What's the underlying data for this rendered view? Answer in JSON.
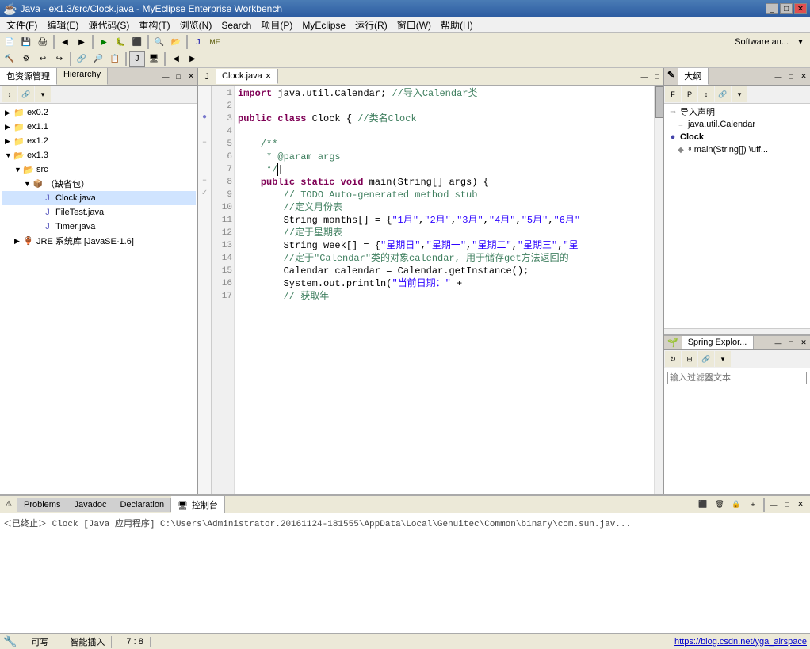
{
  "titleBar": {
    "title": "Java - ex1.3/src/Clock.java - MyEclipse Enterprise Workbench",
    "controls": [
      "minimize",
      "maximize",
      "close"
    ]
  },
  "menuBar": {
    "items": [
      "文件(F)",
      "编辑(E)",
      "源代码(S)",
      "重构(T)",
      "浏览(N)",
      "Search",
      "项目(P)",
      "MyEclipse",
      "运行(R)",
      "窗口(W)",
      "帮助(H)"
    ]
  },
  "leftPanel": {
    "tabs": [
      {
        "label": "包资源管理",
        "active": true
      },
      {
        "label": "Hierarchy",
        "active": false
      }
    ],
    "tree": [
      {
        "level": 0,
        "icon": "folder",
        "label": "ex0.2",
        "type": "project"
      },
      {
        "level": 0,
        "icon": "folder",
        "label": "ex1.1",
        "type": "project"
      },
      {
        "level": 0,
        "icon": "folder",
        "label": "ex1.2",
        "type": "project"
      },
      {
        "level": 0,
        "icon": "folder-open",
        "label": "ex1.3",
        "type": "project",
        "expanded": true
      },
      {
        "level": 1,
        "icon": "folder-open",
        "label": "src",
        "type": "src",
        "expanded": true
      },
      {
        "level": 2,
        "icon": "package",
        "label": "（缺省包）",
        "type": "package",
        "expanded": true
      },
      {
        "level": 3,
        "icon": "java",
        "label": "Clock.java",
        "type": "java",
        "active": true
      },
      {
        "level": 3,
        "icon": "java",
        "label": "FileTest.java",
        "type": "java"
      },
      {
        "level": 3,
        "icon": "java",
        "label": "Timer.java",
        "type": "java"
      },
      {
        "level": 1,
        "icon": "jar",
        "label": "JRE 系统库 [JavaSE-1.6]",
        "type": "jar"
      }
    ]
  },
  "editor": {
    "tabs": [
      {
        "label": "Clock.java",
        "active": true,
        "modified": false
      }
    ],
    "lines": [
      {
        "num": 1,
        "content": "import java.util.Calendar; //导入Calendar类"
      },
      {
        "num": 2,
        "content": ""
      },
      {
        "num": 3,
        "content": "public class Clock { //类名Clock"
      },
      {
        "num": 4,
        "content": ""
      },
      {
        "num": 5,
        "content": "    /**"
      },
      {
        "num": 6,
        "content": "     * @param args"
      },
      {
        "num": 7,
        "content": "     */"
      },
      {
        "num": 8,
        "content": "    public static void main(String[] args) {"
      },
      {
        "num": 9,
        "content": "        // TODO Auto-generated method stub"
      },
      {
        "num": 10,
        "content": "        //定义月份表"
      },
      {
        "num": 11,
        "content": "        String months[] = {\"1月\",\"2月\",\"3月\",\"4月\",\"5月\",\"6月\""
      },
      {
        "num": 12,
        "content": "        //定于星期表"
      },
      {
        "num": 13,
        "content": "        String week[] = {\"星期日\",\"星期一\",\"星期二\",\"星期三\",\"星"
      },
      {
        "num": 14,
        "content": "        //定于\"Calendar\"类的对象calendar, 用于储存get方法返回的"
      },
      {
        "num": 15,
        "content": "        Calendar calendar = Calendar.getInstance();"
      },
      {
        "num": 16,
        "content": "        System.out.println(\"当前日期：\" +"
      },
      {
        "num": 17,
        "content": "        // 获取年"
      }
    ],
    "caretPosition": "7 : 8"
  },
  "rightPanel": {
    "outline": {
      "title": "大纲",
      "items": [
        {
          "label": "导入声明",
          "icon": "import",
          "level": 0
        },
        {
          "label": "java.util.Calendar",
          "icon": "import-item",
          "level": 1
        },
        {
          "label": "Clock",
          "icon": "class",
          "level": 0
        },
        {
          "label": "main(String[]) \\uff...",
          "icon": "method",
          "level": 1
        }
      ]
    },
    "springExplorer": {
      "title": "Spring Explor...",
      "searchPlaceholder": "输入过滤器文本"
    }
  },
  "bottomPanel": {
    "tabs": [
      {
        "label": "Problems",
        "active": false
      },
      {
        "label": "Javadoc",
        "active": false
      },
      {
        "label": "Declaration",
        "active": false
      },
      {
        "label": "控制台",
        "active": true
      }
    ],
    "consoleText": "＜已终止＞ Clock [Java 应用程序] C:\\Users\\Administrator.20161124-181555\\AppData\\Local\\Genuitec\\Common\\binary\\com.sun.jav..."
  },
  "statusBar": {
    "editMode": "可写",
    "insertMode": "智能插入",
    "position": "7 : 8",
    "url": "https://blog.csdn.net/yga_airspace",
    "leftIcon": "🔧"
  }
}
